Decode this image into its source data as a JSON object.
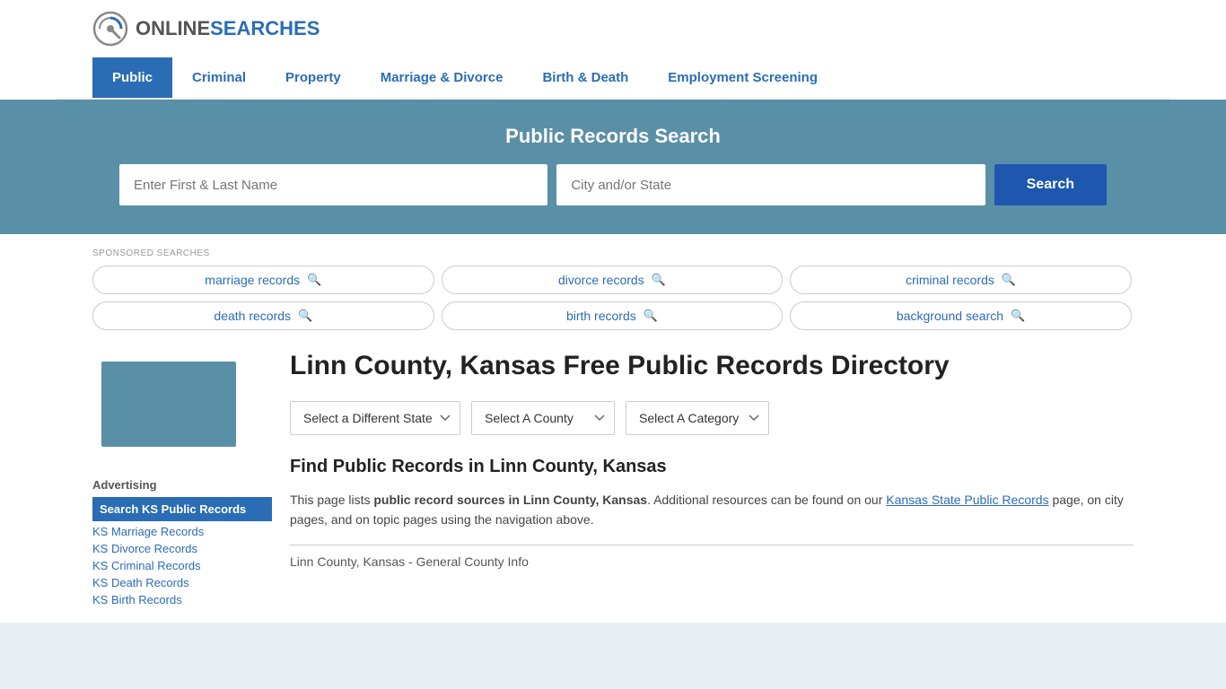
{
  "site": {
    "logo_online": "ONLINE",
    "logo_searches": "SEARCHES"
  },
  "nav": {
    "items": [
      {
        "label": "Public",
        "active": true
      },
      {
        "label": "Criminal",
        "active": false
      },
      {
        "label": "Property",
        "active": false
      },
      {
        "label": "Marriage & Divorce",
        "active": false
      },
      {
        "label": "Birth & Death",
        "active": false
      },
      {
        "label": "Employment Screening",
        "active": false
      }
    ]
  },
  "hero": {
    "title": "Public Records Search",
    "name_placeholder": "Enter First & Last Name",
    "location_placeholder": "City and/or State",
    "search_label": "Search"
  },
  "sponsored": {
    "label": "SPONSORED SEARCHES",
    "tags": [
      {
        "text": "marriage records"
      },
      {
        "text": "divorce records"
      },
      {
        "text": "criminal records"
      },
      {
        "text": "death records"
      },
      {
        "text": "birth records"
      },
      {
        "text": "background search"
      }
    ]
  },
  "page": {
    "title": "Linn County, Kansas Free Public Records Directory",
    "dropdowns": {
      "state": "Select a Different State",
      "county": "Select A County",
      "category": "Select A Category"
    },
    "find_title": "Find Public Records in Linn County, Kansas",
    "description_part1": "This page lists ",
    "description_bold": "public record sources in Linn County, Kansas",
    "description_part2": ". Additional resources can be found on our ",
    "description_link": "Kansas State Public Records",
    "description_part3": " page, on city pages, and on topic pages using the navigation above.",
    "general_info": "Linn County, Kansas - General County Info"
  },
  "sidebar": {
    "advertising_label": "Advertising",
    "highlight_text": "Search KS Public Records",
    "links": [
      {
        "text": "KS Marriage Records"
      },
      {
        "text": "KS Divorce Records"
      },
      {
        "text": "KS Criminal Records"
      },
      {
        "text": "KS Death Records"
      },
      {
        "text": "KS Birth Records"
      }
    ]
  }
}
